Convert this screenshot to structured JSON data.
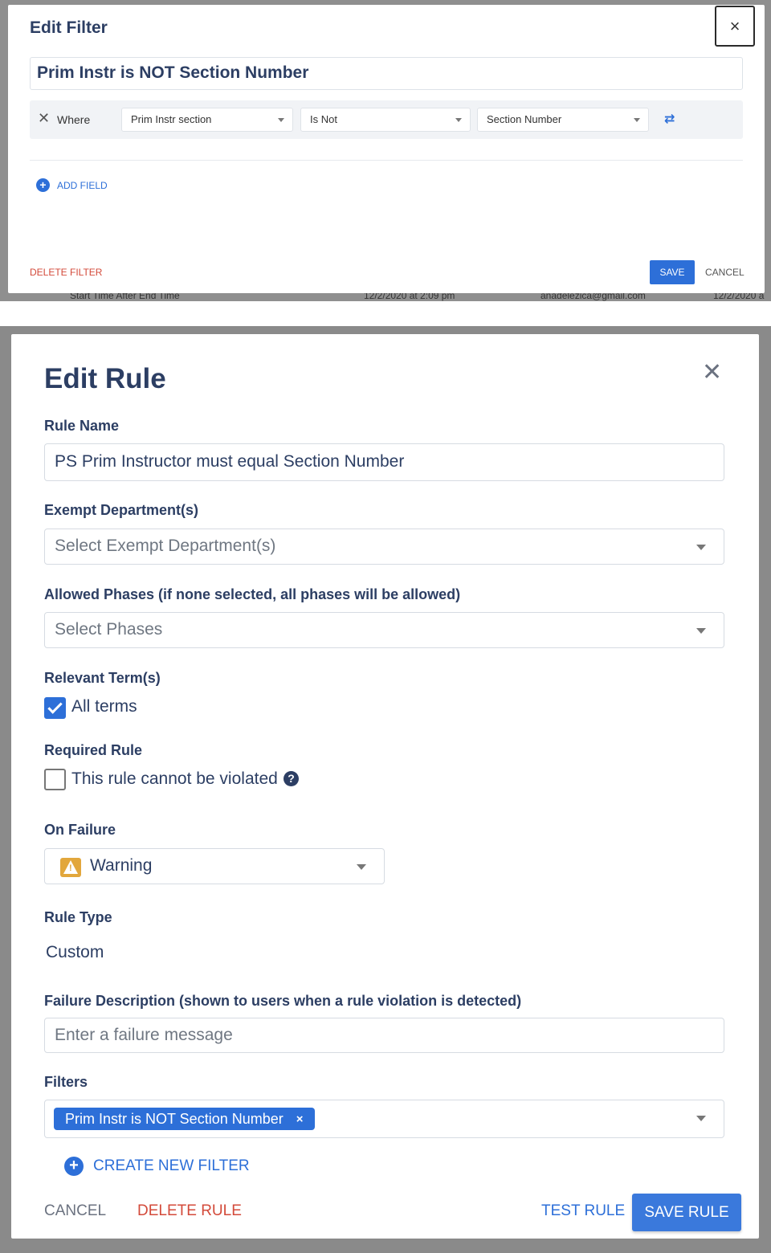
{
  "edit_filter": {
    "title": "Edit Filter",
    "close_label": "×",
    "filter_name": "Prim Instr is NOT Section Number",
    "condition": {
      "where_label": "Where",
      "field": "Prim Instr section",
      "operator": "Is Not",
      "value": "Section Number"
    },
    "add_field_label": "ADD FIELD",
    "delete_label": "DELETE FILTER",
    "save_label": "SAVE",
    "cancel_label": "CANCEL",
    "background_rows": [
      {
        "a": "Start Time After End Time",
        "b": "12/2/2020 at 2:09 pm",
        "c": "anadelezica@gmail.com",
        "d": "12/2/2020 a"
      }
    ]
  },
  "edit_rule": {
    "title": "Edit Rule",
    "close_label": "✕",
    "rule_name": {
      "label": "Rule Name",
      "value": "PS Prim Instructor must equal Section Number"
    },
    "exempt_departments": {
      "label": "Exempt Department(s)",
      "placeholder": "Select Exempt Department(s)"
    },
    "allowed_phases": {
      "label": "Allowed Phases (if none selected, all phases will be allowed)",
      "placeholder": "Select Phases"
    },
    "relevant_terms": {
      "label": "Relevant Term(s)",
      "option": "All terms",
      "checked": true
    },
    "required_rule": {
      "label": "Required Rule",
      "option": "This rule cannot be violated",
      "checked": false,
      "help": "?"
    },
    "on_failure": {
      "label": "On Failure",
      "value": "Warning"
    },
    "rule_type": {
      "label": "Rule Type",
      "value": "Custom"
    },
    "failure_description": {
      "label": "Failure Description (shown to users when a rule violation is detected)",
      "placeholder": "Enter a failure message"
    },
    "filters": {
      "label": "Filters",
      "chips": [
        "Prim Instr is NOT Section Number"
      ],
      "chip_remove": "×"
    },
    "create_filter_label": "CREATE NEW FILTER",
    "cancel_label": "CANCEL",
    "delete_label": "DELETE RULE",
    "test_label": "TEST RULE",
    "save_label": "SAVE RULE"
  },
  "colors": {
    "accent": "#2d6fd8",
    "danger": "#d34a3a",
    "heading": "#2c3e63",
    "warning": "#e2a73c"
  }
}
